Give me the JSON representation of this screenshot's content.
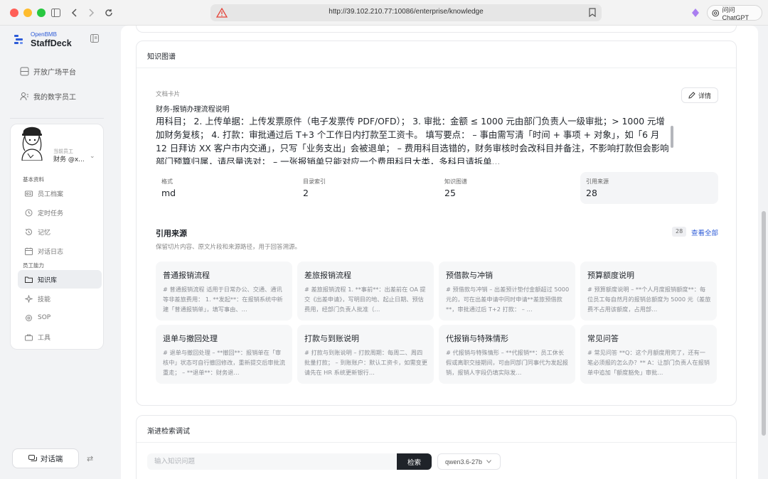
{
  "browser": {
    "url": "http://39.102.210.77:10086/enterprise/knowledge",
    "ask_button": "问问 ChatGPT"
  },
  "sidebar": {
    "brand_top": "OpenBMB",
    "brand_name": "StaffDeck",
    "nav": [
      {
        "label": "开放广场平台",
        "icon": "grid-icon"
      },
      {
        "label": "我的数字员工",
        "icon": "users-icon"
      }
    ],
    "profile": {
      "role_small": "当前员工",
      "role_name": "财务 @x..."
    },
    "section_basic": "基本资料",
    "basic_items": [
      {
        "label": "员工档案",
        "icon": "id-card-icon"
      },
      {
        "label": "定时任务",
        "icon": "clock-icon"
      },
      {
        "label": "记忆",
        "icon": "history-icon"
      },
      {
        "label": "对话日志",
        "icon": "calendar-icon"
      }
    ],
    "section_ability": "员工能力",
    "ability_items": [
      {
        "label": "知识库",
        "icon": "folder-icon",
        "active": true
      },
      {
        "label": "技能",
        "icon": "sparkle-icon"
      },
      {
        "label": "SOP",
        "icon": "sop-icon"
      },
      {
        "label": "工具",
        "icon": "toolbox-icon"
      }
    ],
    "chat_button": "对话端"
  },
  "knowledge": {
    "title": "知识图谱",
    "doc_label": "文档卡片",
    "doc_title": "财务-报销办理流程说明",
    "detail_button": "详情",
    "doc_body": "用科目； 2. 上传单据：上传发票原件（电子发票传 PDF/OFD）； 3. 审批：金额 ≤ 1000 元由部门负责人一级审批；> 1000 元增加财务复核； 4. 打款：审批通过后 T+3 个工作日内打款至工资卡。 填写要点： – 事由需写清「时间 + 事项 + 对象」，如「6 月 12 日拜访 XX 客户市内交通」，只写「业务支出」会被退单； – 费用科目选错的，财务审核时会改科目并备注，不影响打款但会影响部门预算归属，请尽量选对； – 一张报销单只能对应一个费用科目大类，多科目请拆单...",
    "stats": [
      {
        "label": "格式",
        "value": "md"
      },
      {
        "label": "目录索引",
        "value": "2"
      },
      {
        "label": "知识图谱",
        "value": "25"
      },
      {
        "label": "引用来源",
        "value": "28"
      }
    ],
    "refs_title": "引用来源",
    "refs_subtitle": "保留切片内容、原文片段和来源路径，用于回答溯源。",
    "refs_count": "28",
    "refs_view_all": "查看全部",
    "refs": [
      {
        "title": "普通报销流程",
        "snippet": "# 普通报销流程 适用于日常办公、交通、通讯等非差旅费用： 1. **发起**：在报销系统中新建「普通报销单」，填写事由、…"
      },
      {
        "title": "差旅报销流程",
        "snippet": "# 差旅报销流程 1. **事前**：出差前在 OA 提交《出差申请》，写明目的地、起止日期、预估费用，经部门负责人批准（…"
      },
      {
        "title": "预借款与冲销",
        "snippet": "# 预借款与冲销 – 出差预计垫付金额超过 5000 元的，可在出差申请中同时申请**差旅预借款**，审批通过后 T+2 打款： – …"
      },
      {
        "title": "预算额度说明",
        "snippet": "# 预算额度说明 – **个人月度报销额度**：每位员工每自然月的报销总额度为 5000 元（差旅费不占用该额度，占用部…"
      },
      {
        "title": "退单与撤回处理",
        "snippet": "# 退单与撤回处理 – **撤回**：报销单在「审核中」状态可自行撤回修改，重新提交后审批流重走； – **退单**：财务退…"
      },
      {
        "title": "打款与到账说明",
        "snippet": "# 打款与到账说明 – 打款周期：每周二、周四批量打款； – 到账账户：默认工资卡，如需变更请先在 HR 系统更新银行…"
      },
      {
        "title": "代报销与特殊情形",
        "snippet": "# 代报销与特殊情形 – **代报销**：员工休长假或离职交接期间，可由同部门同事代为发起报销，报销人字段仍填实际发…"
      },
      {
        "title": "常见问答",
        "snippet": "# 常见问答 **Q：这个月额度用完了，还有一笔必须报的怎么办？** A：让部门负责人在报销单中追加「额度豁免」审批…"
      }
    ]
  },
  "probe": {
    "title": "渐进检索调试",
    "input_placeholder": "输入知识问题",
    "search_button": "检索",
    "model": "qwen3.6-27b"
  }
}
